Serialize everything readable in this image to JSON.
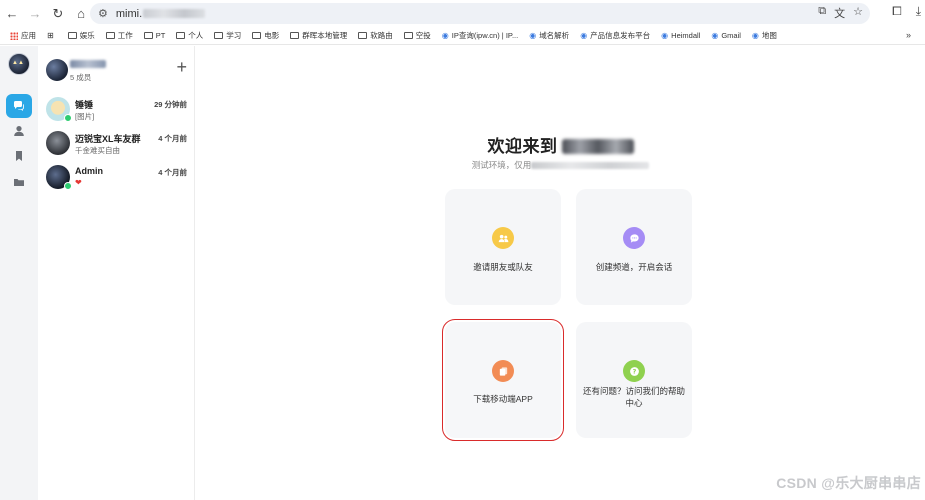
{
  "browser": {
    "url_prefix": "mimi.",
    "bookmarks": [
      {
        "label": "应用",
        "kind": "apps"
      },
      {
        "label": "",
        "kind": "grid"
      },
      {
        "label": "娱乐",
        "kind": "folder"
      },
      {
        "label": "工作",
        "kind": "folder"
      },
      {
        "label": "PT",
        "kind": "folder"
      },
      {
        "label": "个人",
        "kind": "folder"
      },
      {
        "label": "学习",
        "kind": "folder"
      },
      {
        "label": "电影",
        "kind": "folder"
      },
      {
        "label": "群晖本地管理",
        "kind": "folder"
      },
      {
        "label": "软路由",
        "kind": "folder"
      },
      {
        "label": "空投",
        "kind": "folder"
      },
      {
        "label": "IP查询(ipw.cn) | IP...",
        "kind": "site"
      },
      {
        "label": "域名解析",
        "kind": "site"
      },
      {
        "label": "产品信息发布平台",
        "kind": "site"
      },
      {
        "label": "Heimdall",
        "kind": "site"
      },
      {
        "label": "Gmail",
        "kind": "site"
      },
      {
        "label": "地图",
        "kind": "site"
      }
    ]
  },
  "group": {
    "members": "5 成员"
  },
  "chats": [
    {
      "name": "锤锤",
      "time": "29 分钟前",
      "message": "[图片]",
      "online": true
    },
    {
      "name": "迈锐宝XL车友群",
      "time": "4 个月前",
      "message": "千金难买自由",
      "online": false
    },
    {
      "name": "Admin",
      "time": "4 个月前",
      "message": "❤",
      "online": true
    }
  ],
  "welcome": {
    "title": "欢迎来到",
    "subtitle_prefix": "测试环境，仅用"
  },
  "cards": [
    {
      "label": "邀请朋友或队友",
      "icon": "invite-icon",
      "color": "#f7c948"
    },
    {
      "label": "创建频道，开启会话",
      "icon": "channel-icon",
      "color": "#a58cf5"
    },
    {
      "label": "下载移动端APP",
      "icon": "download-app-icon",
      "color": "#f28c55"
    },
    {
      "label": "还有问题？访问我们的帮助中心",
      "icon": "help-icon",
      "color": "#8fd14f"
    }
  ],
  "watermark": "CSDN @乐大厨串串店",
  "colors": {
    "accent": "#2aa7e6",
    "highlight": "#d92b2b"
  }
}
